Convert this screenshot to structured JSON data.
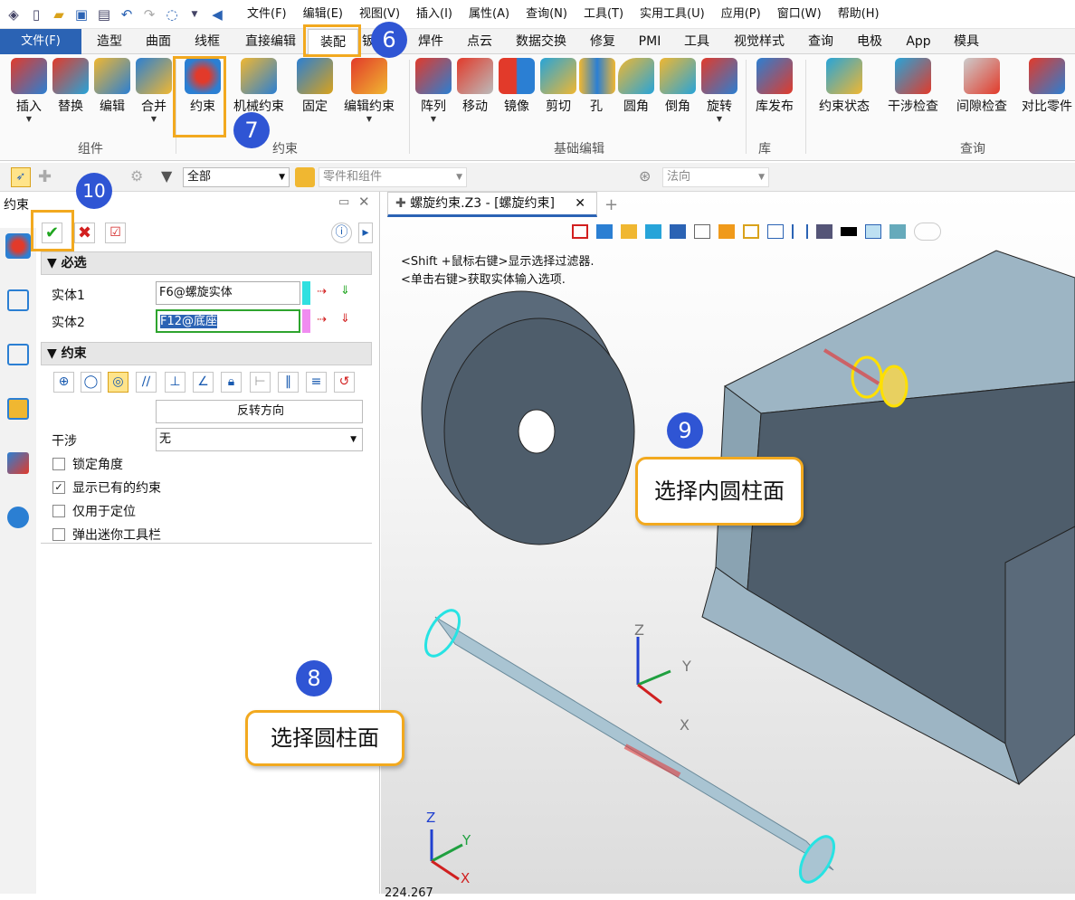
{
  "quick_access": {
    "menu": [
      "文件(F)",
      "编辑(E)",
      "视图(V)",
      "插入(I)",
      "属性(A)",
      "查询(N)",
      "工具(T)",
      "实用工具(U)",
      "应用(P)",
      "窗口(W)",
      "帮助(H)"
    ]
  },
  "tabs": {
    "file": "文件(F)",
    "items": [
      "造型",
      "曲面",
      "线框",
      "直接编辑",
      "装配",
      "钣",
      "焊件",
      "点云",
      "数据交换",
      "修复",
      "PMI",
      "工具",
      "视觉样式",
      "查询",
      "电极",
      "App",
      "模具"
    ]
  },
  "ribbon": {
    "buttons": [
      "插入",
      "替换",
      "编辑",
      "合并",
      "约束",
      "机械约束",
      "固定",
      "编辑约束",
      "阵列",
      "移动",
      "镜像",
      "剪切",
      "孔",
      "圆角",
      "倒角",
      "旋转",
      "库发布",
      "约束状态",
      "干涉检查",
      "间隙检查",
      "对比零件"
    ],
    "groups": [
      "组件",
      "约束",
      "基础编辑",
      "库",
      "查询"
    ]
  },
  "toolbar2": {
    "filter": "全部",
    "pick": "零件和组件",
    "direction": "法向"
  },
  "panel": {
    "title": "约束",
    "required_header": "必选",
    "entity1_label": "实体1",
    "entity1_value": "F6@螺旋实体",
    "entity2_label": "实体2",
    "entity2_value": "F12@底座",
    "constraint_header": "约束",
    "reverse_button": "反转方向",
    "interference_label": "干涉",
    "interference_value": "无",
    "checkboxes": [
      {
        "label": "锁定角度",
        "checked": false
      },
      {
        "label": "显示已有的约束",
        "checked": true
      },
      {
        "label": "仅用于定位",
        "checked": false
      },
      {
        "label": "弹出迷你工具栏",
        "checked": false
      }
    ]
  },
  "viewport": {
    "doc_tab": "螺旋约束.Z3 - [螺旋约束]",
    "hint1": "<Shift +鼠标右键>显示选择过滤器.",
    "hint2": "<单击右键>获取实体输入选项.",
    "axes": {
      "x": "X",
      "y": "Y",
      "z": "Z"
    },
    "bottom_text": "224.267"
  },
  "annotations": {
    "n6": "6",
    "n7": "7",
    "n8": "8",
    "n9": "9",
    "n10": "10",
    "callout8": "选择圆柱面",
    "callout9": "选择内圆柱面"
  },
  "colors": {
    "accent": "#2b63b4",
    "callout_border": "#f2a91f",
    "badge": "#2f55d4"
  }
}
